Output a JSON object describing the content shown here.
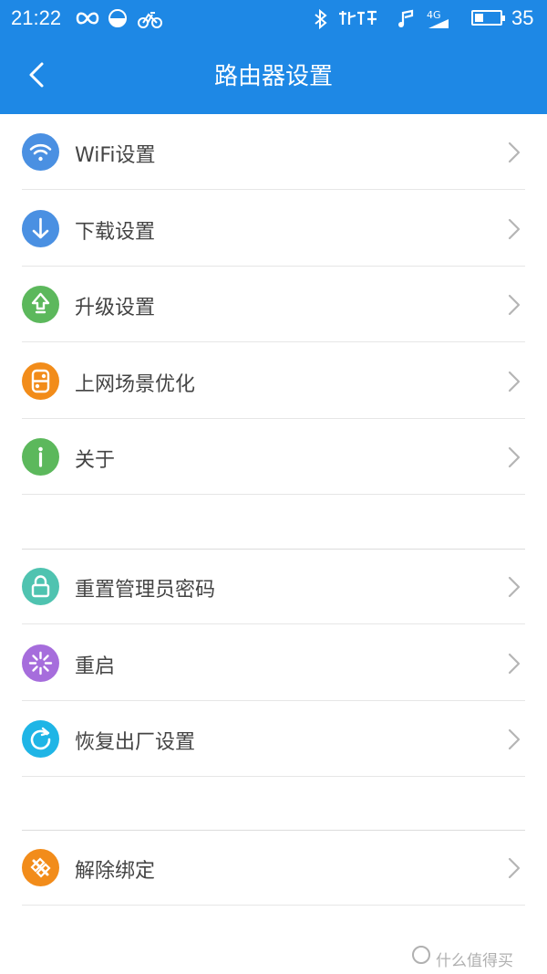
{
  "status_bar": {
    "time": "21:22",
    "network": "4G",
    "battery_percent": "35",
    "battery_level": 0.35
  },
  "header": {
    "title": "路由器设置",
    "background": "#1e88e5"
  },
  "groups": [
    {
      "items": [
        {
          "label": "WiFi设置",
          "icon": "wifi-icon",
          "color": "#4a90e2"
        },
        {
          "label": "下载设置",
          "icon": "download-icon",
          "color": "#4a90e2"
        },
        {
          "label": "升级设置",
          "icon": "upgrade-icon",
          "color": "#5cb85c"
        },
        {
          "label": "上网场景优化",
          "icon": "toggle-icon",
          "color": "#f28c1a"
        },
        {
          "label": "关于",
          "icon": "info-icon",
          "color": "#5cb85c"
        }
      ]
    },
    {
      "items": [
        {
          "label": "重置管理员密码",
          "icon": "lock-icon",
          "color": "#4fc3b0"
        },
        {
          "label": "重启",
          "icon": "restart-icon",
          "color": "#a66ddc"
        },
        {
          "label": "恢复出厂设置",
          "icon": "refresh-icon",
          "color": "#1fb5e6"
        }
      ]
    },
    {
      "items": [
        {
          "label": "解除绑定",
          "icon": "unbind-icon",
          "color": "#f28c1a"
        }
      ]
    }
  ],
  "watermark": "什么值得买"
}
